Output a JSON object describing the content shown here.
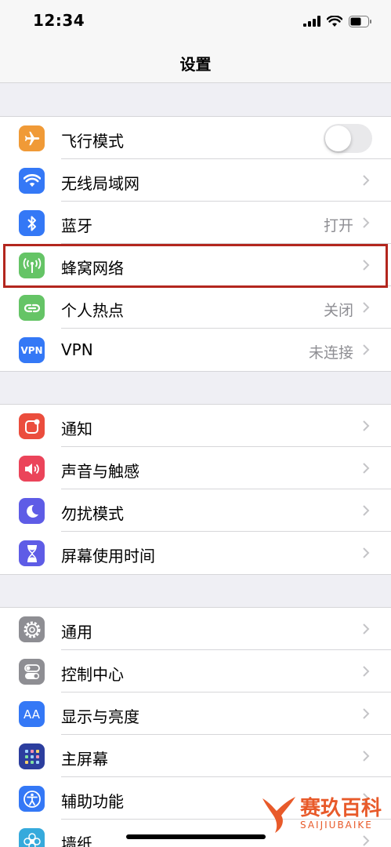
{
  "status_bar": {
    "time": "12:34"
  },
  "nav": {
    "title": "设置"
  },
  "groups": [
    {
      "items": [
        {
          "label": "飞行模式",
          "icon": "airplane-icon",
          "color": "#f09a37",
          "toggle": false
        },
        {
          "label": "无线局域网",
          "icon": "wifi-icon",
          "color": "#3478f6"
        },
        {
          "label": "蓝牙",
          "icon": "bluetooth-icon",
          "color": "#3478f6",
          "value": "打开"
        },
        {
          "label": "蜂窝网络",
          "icon": "cellular-antenna-icon",
          "color": "#65c466",
          "highlighted": true
        },
        {
          "label": "个人热点",
          "icon": "hotspot-link-icon",
          "color": "#65c466",
          "value": "关闭"
        },
        {
          "label": "VPN",
          "icon": "vpn-icon",
          "icon_text": "VPN",
          "color": "#3478f6",
          "value": "未连接"
        }
      ]
    },
    {
      "items": [
        {
          "label": "通知",
          "icon": "notifications-icon",
          "color": "#eb4d3d"
        },
        {
          "label": "声音与触感",
          "icon": "speaker-icon",
          "color": "#eb445a"
        },
        {
          "label": "勿扰模式",
          "icon": "moon-icon",
          "color": "#5e5ce6"
        },
        {
          "label": "屏幕使用时间",
          "icon": "hourglass-icon",
          "color": "#5e5ce6"
        }
      ]
    },
    {
      "items": [
        {
          "label": "通用",
          "icon": "gear-icon",
          "color": "#8e8e93"
        },
        {
          "label": "控制中心",
          "icon": "toggles-icon",
          "color": "#8e8e93"
        },
        {
          "label": "显示与亮度",
          "icon": "text-size-icon",
          "icon_text": "AA",
          "color": "#3478f6"
        },
        {
          "label": "主屏幕",
          "icon": "home-grid-icon",
          "color": "#2c3e9e"
        },
        {
          "label": "辅助功能",
          "icon": "accessibility-icon",
          "color": "#3478f6"
        },
        {
          "label": "墙纸",
          "icon": "wallpaper-flower-icon",
          "color": "#36aadc"
        }
      ]
    }
  ],
  "watermark": {
    "title": "赛玖百科",
    "subtitle": "SAIJIUBAIKE"
  }
}
